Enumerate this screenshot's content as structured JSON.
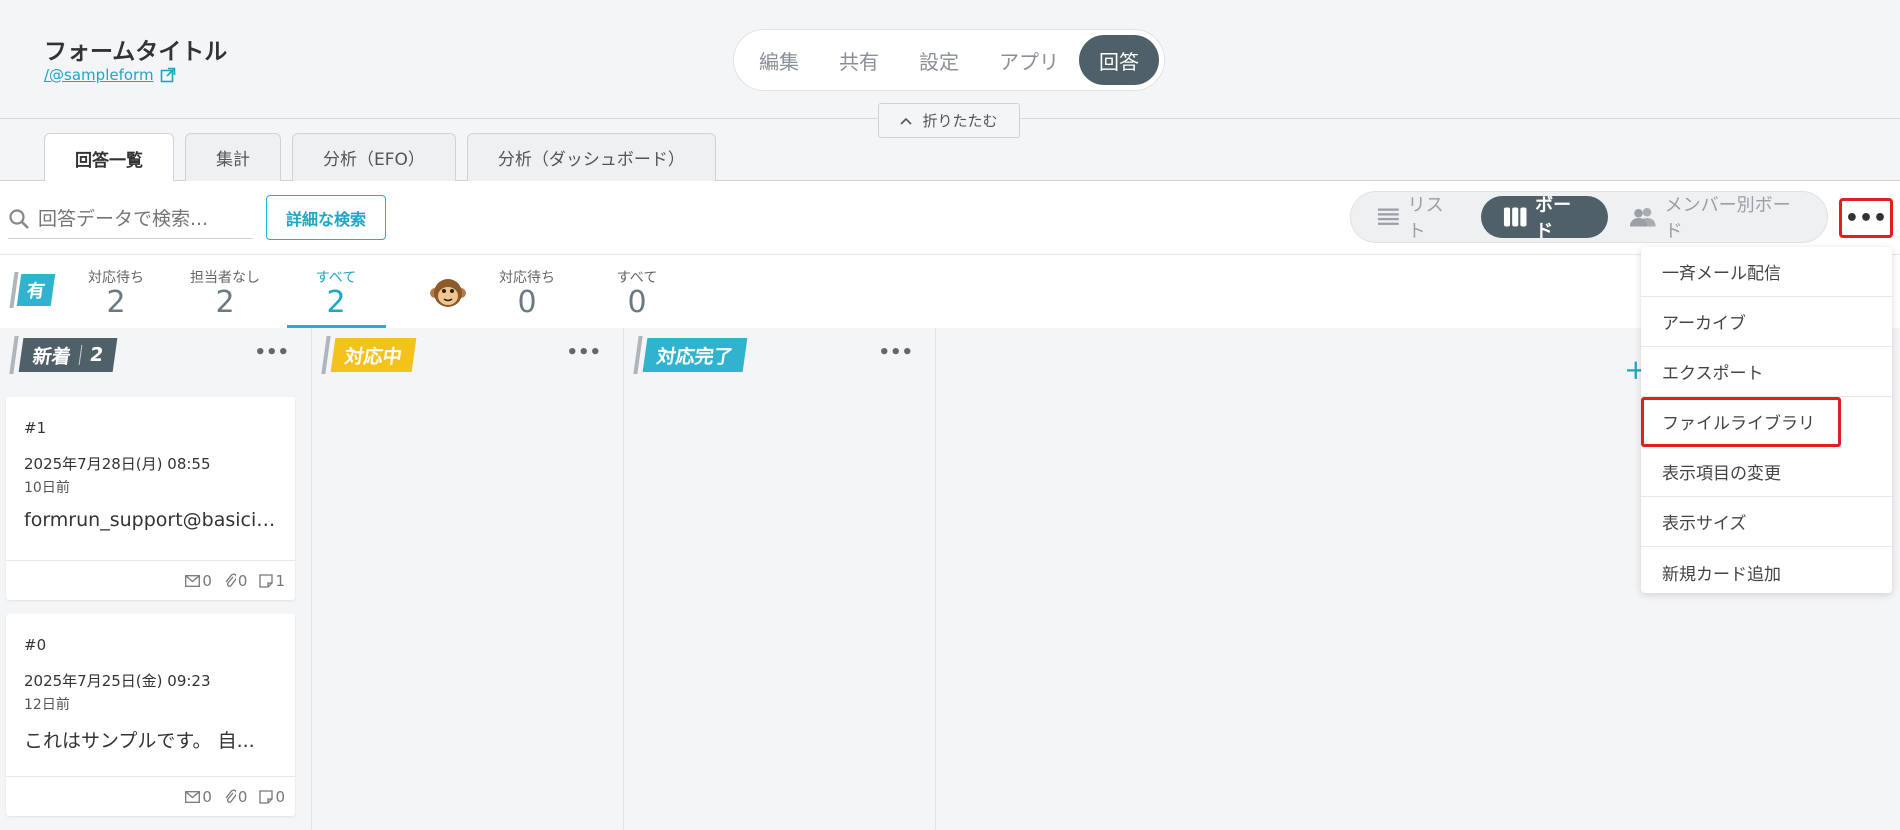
{
  "header": {
    "form_title": "フォームタイトル",
    "form_link": "/@sampleform",
    "nav": [
      "編集",
      "共有",
      "設定",
      "アプリ",
      "回答"
    ],
    "active_nav": "回答",
    "collapse_label": "折りたたむ"
  },
  "tabs": [
    "回答一覧",
    "集計",
    "分析（EFO）",
    "分析（ダッシュボード）"
  ],
  "toolbar": {
    "search_placeholder": "回答データで検索...",
    "advanced_search": "詳細な検索",
    "views": [
      "リスト",
      "ボード",
      "メンバー別ボード"
    ],
    "active_view": "ボード",
    "more_label": "•••"
  },
  "stats": {
    "team_label": "有",
    "team_items": [
      {
        "label": "対応待ち",
        "value": "2"
      },
      {
        "label": "担当者なし",
        "value": "2"
      },
      {
        "label": "すべて",
        "value": "2"
      }
    ],
    "member_items": [
      {
        "label": "対応待ち",
        "value": "0"
      },
      {
        "label": "すべて",
        "value": "0"
      }
    ]
  },
  "board": {
    "columns": [
      {
        "label": "新着",
        "count": "2",
        "color": "#4f6068"
      },
      {
        "label": "対応中",
        "color": "#f5c21b"
      },
      {
        "label": "対応完了",
        "color": "#2fb3cf"
      }
    ],
    "col_menu": "•••",
    "add_column": "+",
    "cards": [
      {
        "num": "#1",
        "date": "2025年7月28日(月) 08:55",
        "ago": "10日前",
        "text": "formrun_support@basicinc...",
        "mail": "0",
        "attach": "0",
        "memo": "1"
      },
      {
        "num": "#0",
        "date": "2025年7月25日(金) 09:23",
        "ago": "12日前",
        "text": "これはサンプルです。 自...",
        "mail": "0",
        "attach": "0",
        "memo": "0"
      }
    ]
  },
  "menu": {
    "items": [
      "一斉メール配信",
      "アーカイブ",
      "エクスポート",
      "ファイルライブラリ",
      "表示項目の変更",
      "表示サイズ",
      "新規カード追加"
    ],
    "highlighted": "ファイルライブラリ"
  }
}
